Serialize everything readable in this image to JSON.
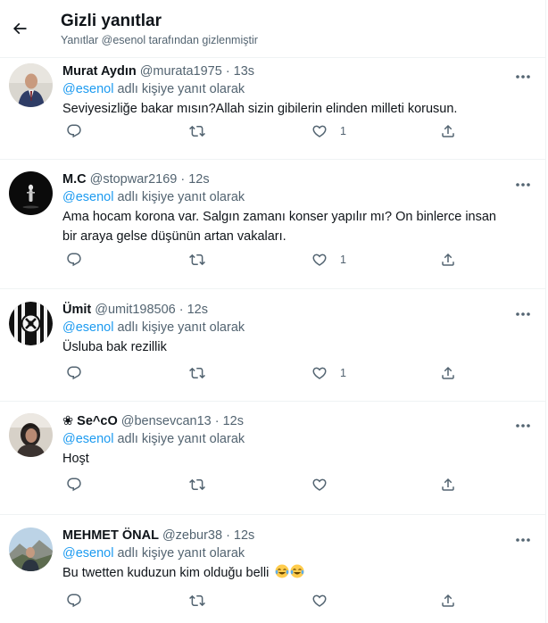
{
  "header": {
    "title": "Gizli yanıtlar",
    "subtitle": "Yanıtlar @esenol tarafından gizlenmiştir"
  },
  "tweets": [
    {
      "name": "Murat Aydın",
      "handle": "@murata1975",
      "time": "13s",
      "reply_mention": "@esenol",
      "reply_suffix": " adlı kişiye yanıt olarak",
      "lines": [
        "Seviyesizliğe bakar mısın?Allah sizin gibilerin elinden milleti korusun."
      ],
      "like_count": "1"
    },
    {
      "name": "M.C",
      "handle": "@stopwar2169",
      "time": "12s",
      "reply_mention": "@esenol",
      "reply_suffix": " adlı kişiye yanıt olarak",
      "lines": [
        "Ama hocam korona var. Salgın zamanı konser yapılır mı? On binlerce insan",
        "bir araya gelse düşünün artan vakaları."
      ],
      "like_count": "1"
    },
    {
      "name": "Ümit",
      "handle": "@umit198506",
      "time": "12s",
      "reply_mention": "@esenol",
      "reply_suffix": " adlı kişiye yanıt olarak",
      "lines": [
        "Üsluba bak rezillik"
      ],
      "like_count": "1"
    },
    {
      "name": "❀ Se^cO",
      "handle": "@bensevcan13",
      "time": "12s",
      "reply_mention": "@esenol",
      "reply_suffix": " adlı kişiye yanıt olarak",
      "lines": [
        "Hoşt"
      ],
      "like_count": ""
    },
    {
      "name": "MEHMET ÖNAL",
      "handle": "@zebur38",
      "time": "12s",
      "reply_mention": "@esenol",
      "reply_suffix": " adlı kişiye yanıt olarak",
      "lines": [
        "Bu twetten kuduzun kim olduğu belli"
      ],
      "emoji": [
        "face-with-tears-of-joy",
        "face-with-tears-of-joy"
      ],
      "like_count": ""
    }
  ],
  "separator": "·",
  "icons": {
    "back": "back-arrow-icon",
    "more": "more-icon",
    "reply": "reply-icon",
    "retweet": "retweet-icon",
    "like": "like-icon",
    "share": "share-icon"
  },
  "colors": {
    "accent": "#1d9bf0",
    "secondary_text": "#536471",
    "primary_text": "#0f1419",
    "divider": "#eff3f4"
  }
}
